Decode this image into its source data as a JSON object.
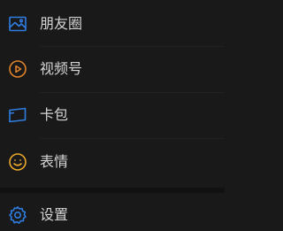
{
  "menu": {
    "items": [
      {
        "label": "朋友圈",
        "icon": "moments-icon",
        "color": "#2f7de1"
      },
      {
        "label": "视频号",
        "icon": "channels-icon",
        "color": "#e0822a"
      },
      {
        "label": "卡包",
        "icon": "card-wallet-icon",
        "color": "#2f7de1"
      },
      {
        "label": "表情",
        "icon": "sticker-smile-icon",
        "color": "#e9a92b"
      }
    ],
    "settings": {
      "label": "设置",
      "icon": "settings-gear-icon",
      "color": "#2f7de1"
    }
  },
  "colors": {
    "background": "#191919",
    "separator": "#111111",
    "text": "#d5d5d5"
  }
}
